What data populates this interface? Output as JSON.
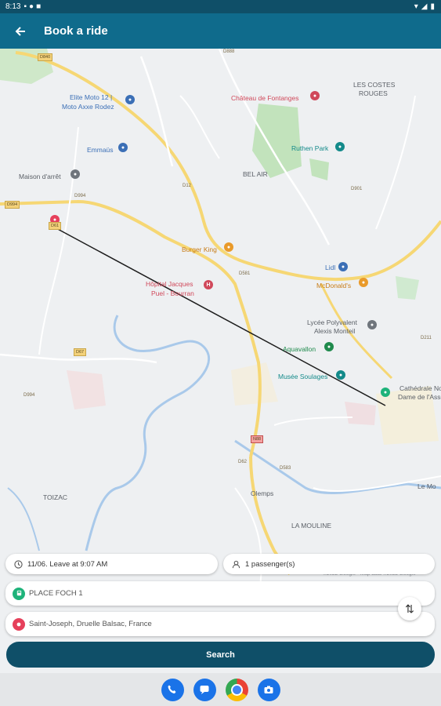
{
  "status_bar": {
    "time": "8:13"
  },
  "app_bar": {
    "title": "Book a ride"
  },
  "map": {
    "labels": {
      "elite_moto": "Elite Moto 12 |",
      "elite_moto_2": "Moto Axxe Rodez",
      "emmaus": "Emmaüs",
      "maison_arret": "Maison d'arrêt",
      "chateau": "Château de Fontanges",
      "costes": "LES COSTES",
      "rouges": "ROUGES",
      "ruthen_park": "Ruthen Park",
      "bel_air": "BEL AIR",
      "burger_king": "Burger King",
      "lidl": "Lidl",
      "mcdonalds": "McDonald's",
      "hopital": "Hôpital Jacques",
      "hopital_2": "Puel - Bourran",
      "lycee": "Lycée Polyvalent",
      "lycee_2": "Alexis Monteil",
      "aquavallon": "Aquavallon",
      "musee": "Musée Soulages",
      "cathedrale": "Cathédrale Notre",
      "cathedrale_2": "Dame de l'Assomption",
      "toizac": "TOIZAC",
      "olemps": "Olemps",
      "la_mouline": "LA MOULINE",
      "le_mo": "Le Mo",
      "copyright": "©2022 Google · Map data ©2022 Google"
    },
    "roads": {
      "d840": "D840",
      "d994": "D994",
      "d994b": "D994",
      "d994c": "D994",
      "d61": "D61",
      "d888": "D888",
      "d12": "D12",
      "d67": "D67",
      "d581": "D581",
      "d901": "D901",
      "d211": "D211",
      "d583": "D583",
      "n88": "N88",
      "d62": "D62"
    }
  },
  "form": {
    "datetime": "11/06. Leave at 9:07 AM",
    "passengers": "1 passenger(s)",
    "origin": "PLACE FOCH 1",
    "destination": "Saint-Joseph, Druelle Balsac, France",
    "search_label": "Search"
  },
  "colors": {
    "app_bar": "#0f6b8c",
    "status_bar": "#0f4f68",
    "search_button": "#0f4f68",
    "origin_marker": "#1eb37a",
    "destination_marker": "#e6405b"
  },
  "dock": {
    "apps": [
      "phone-icon",
      "messages-icon",
      "chrome-icon",
      "camera-icon"
    ]
  }
}
